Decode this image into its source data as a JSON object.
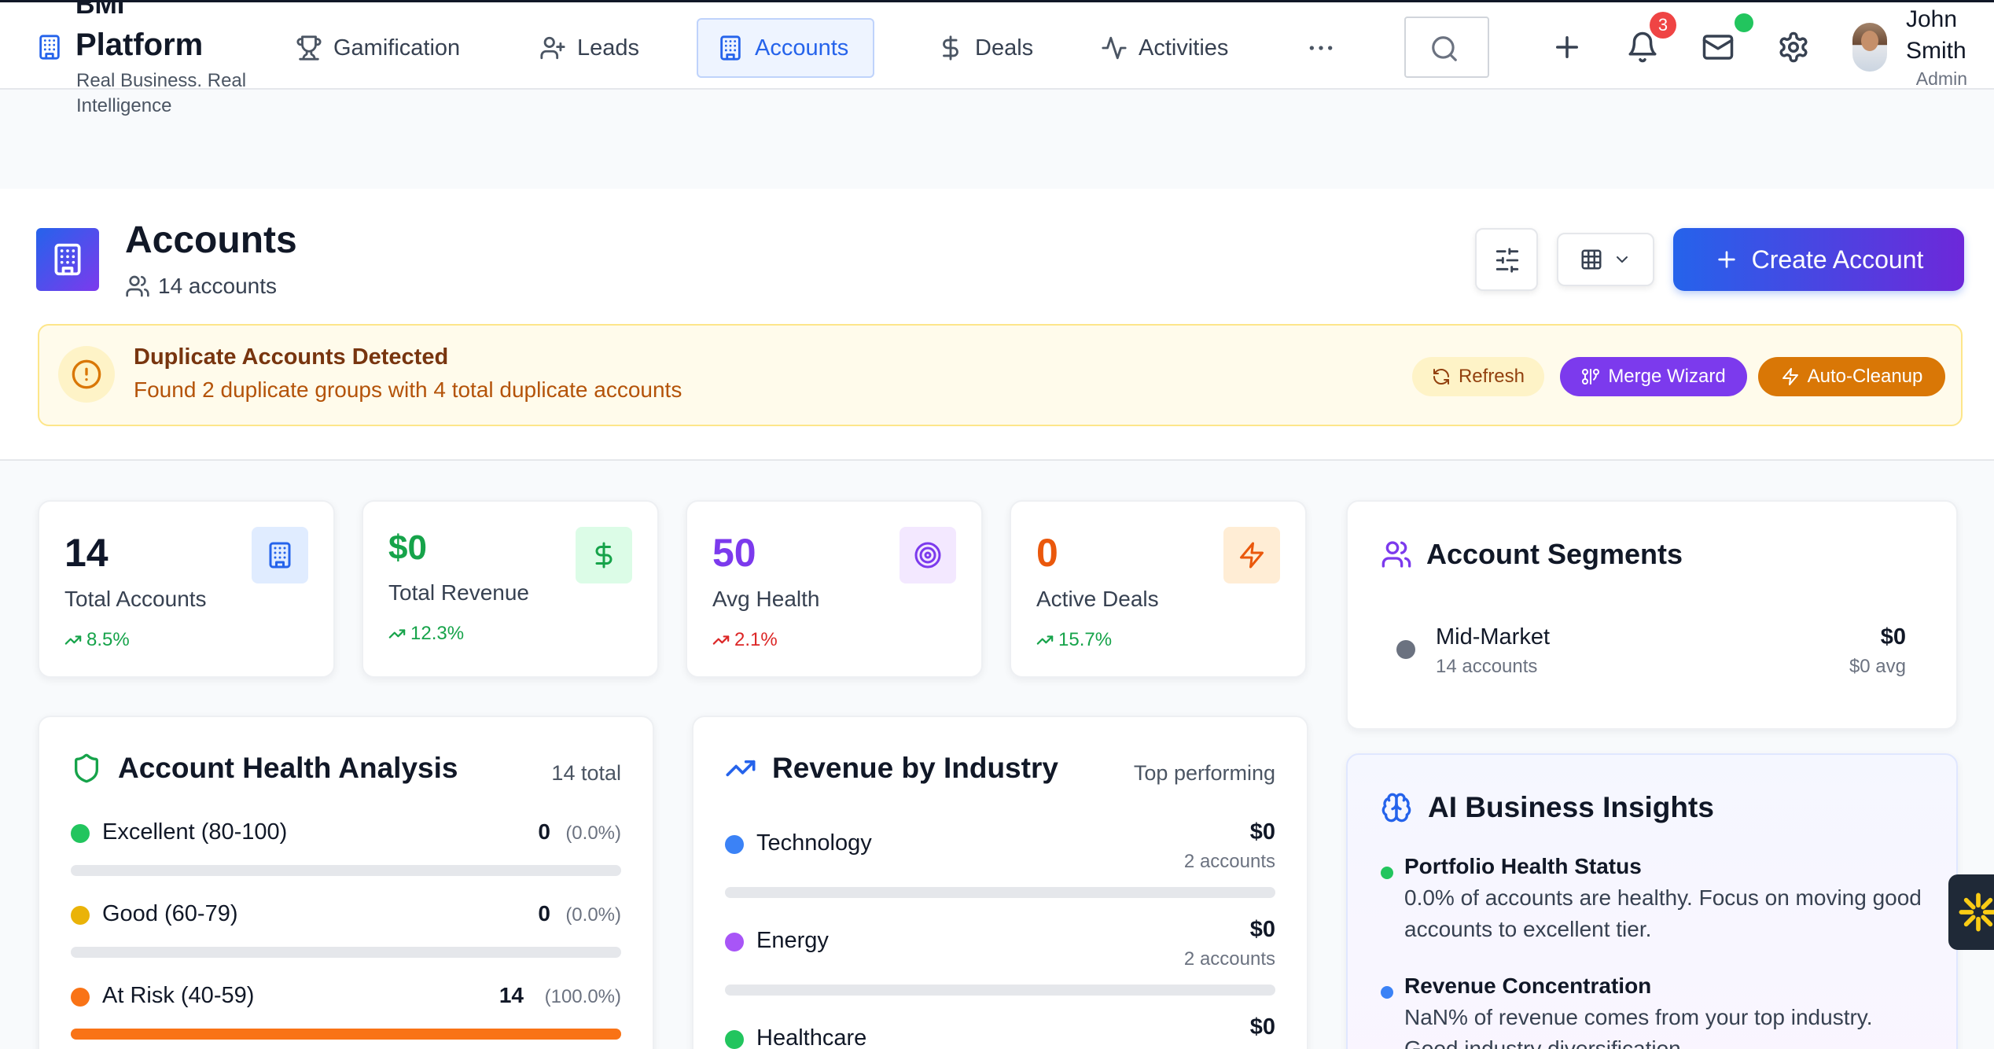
{
  "brand": {
    "name_cut": "BMI",
    "name": "Platform",
    "tagline": "Real Business. Real Intelligence"
  },
  "nav": {
    "items": [
      {
        "label": "Gamification",
        "icon": "trophy-icon"
      },
      {
        "label": "Leads",
        "icon": "user-plus-icon"
      },
      {
        "label": "Accounts",
        "icon": "building-icon",
        "active": true
      },
      {
        "label": "Deals",
        "icon": "dollar-icon"
      },
      {
        "label": "Activities",
        "icon": "activity-icon"
      }
    ],
    "notifications_count": "3"
  },
  "user": {
    "name": "John Smith",
    "role": "Admin"
  },
  "page": {
    "title": "Accounts",
    "count_text": "14 accounts",
    "create_label": "Create Account"
  },
  "alert": {
    "title": "Duplicate Accounts Detected",
    "text": "Found 2 duplicate groups with 4 total duplicate accounts",
    "refresh_label": "Refresh",
    "merge_label": "Merge Wizard",
    "cleanup_label": "Auto-Cleanup"
  },
  "stats": [
    {
      "value": "14",
      "label": "Total Accounts",
      "trend": "8.5%",
      "trend_dir": "up",
      "color": "#0f172a",
      "icon": "building-icon"
    },
    {
      "value": "$0",
      "label": "Total Revenue",
      "trend": "12.3%",
      "trend_dir": "up",
      "color": "#16a34a",
      "icon": "dollar-icon"
    },
    {
      "value": "50",
      "label": "Avg Health",
      "trend": "2.1%",
      "trend_dir": "down",
      "color": "#7c3aed",
      "icon": "target-icon"
    },
    {
      "value": "0",
      "label": "Active Deals",
      "trend": "15.7%",
      "trend_dir": "up",
      "color": "#ea580c",
      "icon": "zap-icon"
    }
  ],
  "segments": {
    "title": "Account Segments",
    "items": [
      {
        "name": "Mid-Market",
        "count": "14 accounts",
        "value": "$0",
        "avg": "$0 avg"
      }
    ]
  },
  "health": {
    "title": "Account Health Analysis",
    "total": "14 total",
    "rows": [
      {
        "label": "Excellent (80-100)",
        "count": "0",
        "pct": "(0.0%)",
        "fill": 0.0,
        "color": "#22c55e"
      },
      {
        "label": "Good (60-79)",
        "count": "0",
        "pct": "(0.0%)",
        "fill": 0.0,
        "color": "#eab308"
      },
      {
        "label": "At Risk (40-59)",
        "count": "14",
        "pct": "(100.0%)",
        "fill": 1.0,
        "color": "#f97316"
      }
    ]
  },
  "industry": {
    "title": "Revenue by Industry",
    "subtitle": "Top performing",
    "rows": [
      {
        "label": "Technology",
        "value": "$0",
        "count": "2 accounts",
        "color": "#3b82f6"
      },
      {
        "label": "Energy",
        "value": "$0",
        "count": "2 accounts",
        "color": "#a855f7"
      },
      {
        "label": "Healthcare",
        "value": "$0",
        "count": "",
        "color": "#22c55e"
      }
    ]
  },
  "insights": {
    "title": "AI Business Insights",
    "items": [
      {
        "title": "Portfolio Health Status",
        "text": "0.0% of accounts are healthy. Focus on moving good accounts to excellent tier.",
        "color": "#22c55e"
      },
      {
        "title": "Revenue Concentration",
        "text": "NaN% of revenue comes from your top industry. Good industry diversification.",
        "color": "#3b82f6"
      }
    ]
  }
}
